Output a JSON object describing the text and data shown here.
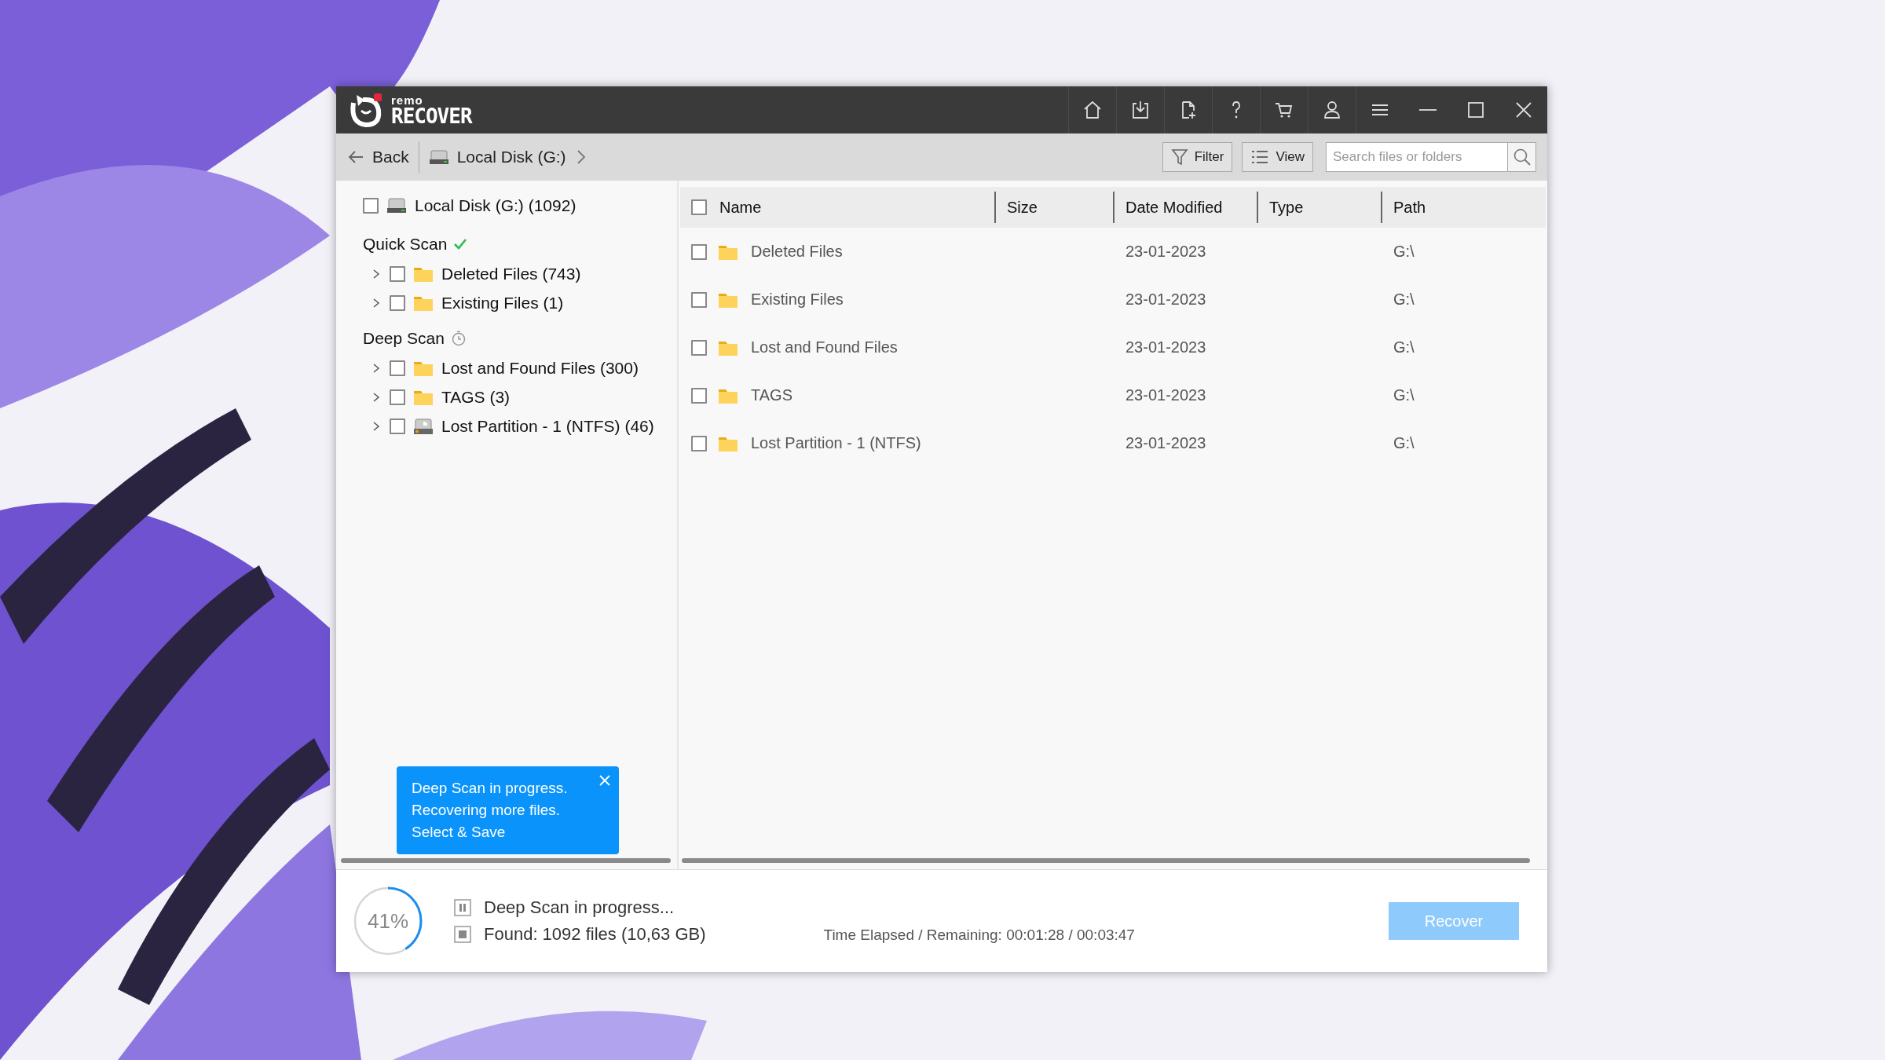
{
  "app": {
    "logo_top": "remo",
    "logo_main": "RECOVER"
  },
  "toolbar": {
    "back": "Back",
    "breadcrumb": "Local Disk (G:)",
    "filter": "Filter",
    "view": "View",
    "search": {
      "placeholder": "Search files or folders"
    }
  },
  "sidebar": {
    "root": {
      "label": "Local Disk (G:) (1092)",
      "checked": false
    },
    "sections": [
      {
        "title": "Quick Scan",
        "scan_complete": true,
        "items": [
          {
            "label": "Deleted Files (743)",
            "kind": "folder",
            "checked": false,
            "expanded": false
          },
          {
            "label": "Existing Files (1)",
            "kind": "folder",
            "checked": false,
            "expanded": false
          }
        ]
      },
      {
        "title": "Deep Scan",
        "scan_complete": false,
        "items": [
          {
            "label": "Lost and Found Files (300)",
            "kind": "folder",
            "checked": false,
            "expanded": false
          },
          {
            "label": "TAGS (3)",
            "kind": "folder",
            "checked": false,
            "expanded": false
          },
          {
            "label": "Lost Partition - 1 (NTFS) (46)",
            "kind": "partition",
            "checked": false,
            "expanded": false
          }
        ]
      }
    ]
  },
  "table": {
    "all_checked": false,
    "columns": [
      "Name",
      "Size",
      "Date Modified",
      "Type",
      "Path"
    ],
    "rows": [
      {
        "name": "Deleted Files",
        "date": "23-01-2023",
        "path": "G:\\",
        "checked": false
      },
      {
        "name": "Existing Files",
        "date": "23-01-2023",
        "path": "G:\\",
        "checked": false
      },
      {
        "name": "Lost and Found Files",
        "date": "23-01-2023",
        "path": "G:\\",
        "checked": false
      },
      {
        "name": "TAGS",
        "date": "23-01-2023",
        "path": "G:\\",
        "checked": false
      },
      {
        "name": "Lost Partition - 1 (NTFS)",
        "date": "23-01-2023",
        "path": "G:\\",
        "checked": false
      }
    ]
  },
  "toast": {
    "lines": [
      "Deep Scan in progress.",
      "Recovering more files.",
      "Select & Save"
    ]
  },
  "status": {
    "progress": {
      "level": 0.41,
      "label": "41%"
    },
    "title": "Deep Scan in progress...",
    "found": "Found: 1092 files (10,63 GB)",
    "time": "Time Elapsed / Remaining: 00:01:28 / 00:03:47",
    "recover": {
      "label": "Recover",
      "disabled": true
    }
  }
}
